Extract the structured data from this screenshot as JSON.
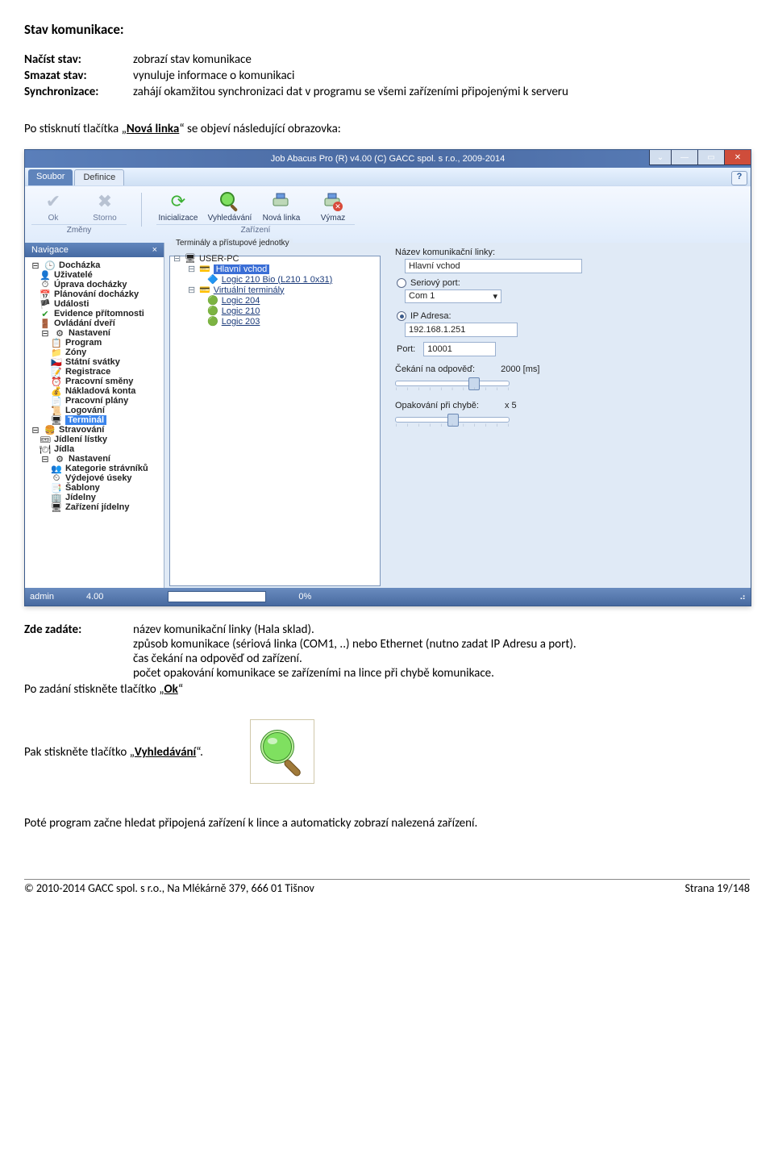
{
  "heading": "Stav komunikace:",
  "defs": {
    "nacist": {
      "label": "Načíst stav:",
      "text": "zobrazí stav komunikace"
    },
    "smazat": {
      "label": "Smazat stav:",
      "text": "vynuluje informace o komunikaci"
    },
    "sync": {
      "label": "Synchronizace:",
      "text": "zahájí okamžitou synchronizaci dat v programu se všemi zařízeními připojenými k serveru"
    }
  },
  "para1_a": "Po stisknutí tlačítka „",
  "para1_bold": "Nová linka",
  "para1_b": "“ se objeví následující obrazovka:",
  "app": {
    "title": "Job Abacus Pro (R) v4.00 (C) GACC spol. s r.o., 2009-2014",
    "menu": {
      "soubor": "Soubor",
      "definice": "Definice"
    },
    "ribbon": {
      "group1": "Změny",
      "group2": "Zařízení",
      "ok": "Ok",
      "storno": "Storno",
      "inicializace": "Inicializace",
      "vyhledavani": "Vyhledávání",
      "novalinka": "Nová linka",
      "vymaz": "Výmaz"
    },
    "nav": {
      "title": "Navigace",
      "dochazka": "Docházka",
      "uzivatele": "Uživatelé",
      "uprava": "Úprava docházky",
      "planovani": "Plánování docházky",
      "udalosti": "Události",
      "evidence": "Evidence přítomnosti",
      "ovladani": "Ovládání dveří",
      "nastaveni1": "Nastavení",
      "program": "Program",
      "zony": "Zóny",
      "svatky": "Státní svátky",
      "registrace": "Registrace",
      "smeny": "Pracovní směny",
      "nakladova": "Nákladová konta",
      "plany": "Pracovní plány",
      "logovani": "Logování",
      "terminal": "Terminál",
      "stravovani": "Stravování",
      "listky": "Jídlení lístky",
      "jidla": "Jídla",
      "nastaveni2": "Nastavení",
      "kategorie": "Kategorie strávníků",
      "useky": "Výdejové úseky",
      "sablony": "Šablony",
      "jidelny": "Jídelny",
      "zarizeni": "Zařízení jídelny"
    },
    "terminals": {
      "title": "Terminály a přístupové jednotky",
      "userpc": "USER-PC",
      "hlavni": "Hlavní vchod",
      "logic210bio": "Logic 210 Bio (L210 1 0x31)",
      "virtual": "Virtuální terminály",
      "l204": "Logic 204",
      "l210": "Logic 210",
      "l203": "Logic 203"
    },
    "details": {
      "nazevLabel": "Název komunikační linky:",
      "nazevVal": "Hlavní vchod",
      "serialLabel": "Seriový port:",
      "com": "Com 1",
      "ipLabel": "IP Adresa:",
      "ipVal": "192.168.1.251",
      "portLabel": "Port:",
      "portVal": "10001",
      "cekaniLabel": "Čekání na odpověď:",
      "cekaniVal": "2000 [ms]",
      "opakLabel": "Opakování při chybě:",
      "opakVal": "x 5"
    },
    "status": {
      "user": "admin",
      "ver": "4.00",
      "prog": "0%"
    }
  },
  "zde_label": "Zde zadáte:",
  "zde_lines": {
    "a": "název komunikační linky (Hala sklad).",
    "b": "způsob komunikace (sériová linka (COM1, ..) nebo Ethernet (nutno zadat IP Adresu a port).",
    "c": "čas čekání na odpověď od zařízení.",
    "d": "počet opakování komunikace se zařízeními na lince při chybě komunikace."
  },
  "pozadani_a": "Po zadání stiskněte tlačítko „",
  "pozadani_bold": "Ok",
  "pozadani_b": "“",
  "pak_a": "Pak stiskněte tlačítko „",
  "pak_bold": "Vyhledávání",
  "pak_b": "“.",
  "pote": "Poté program začne hledat připojená zařízení k lince a automaticky zobrazí nalezená zařízení.",
  "footer": {
    "left": "© 2010-2014 GACC spol. s r.o., Na Mlékárně 379, 666 01 Tišnov",
    "right": "Strana 19/148"
  }
}
